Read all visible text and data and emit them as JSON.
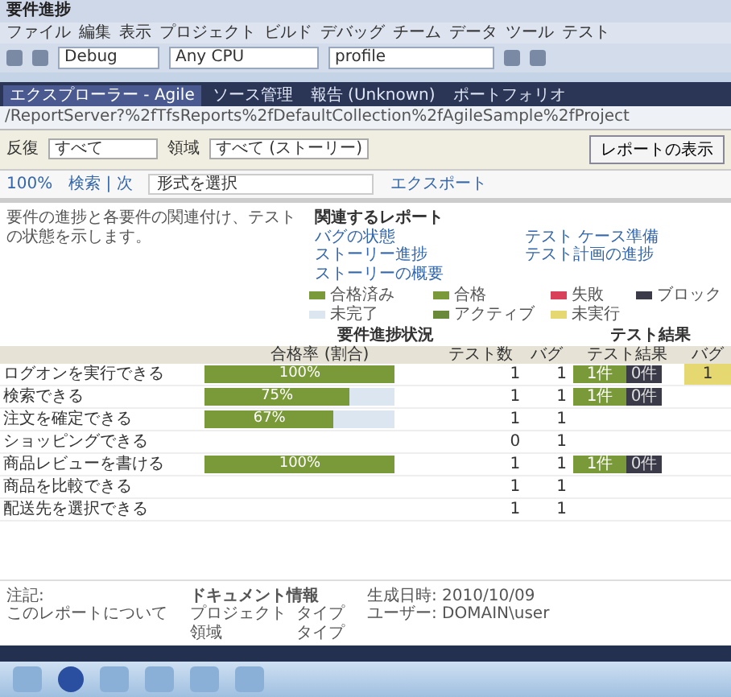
{
  "window": {
    "title": "要件進捗"
  },
  "menu": [
    "ファイル",
    "編集",
    "表示",
    "プロジェクト",
    "ビルド",
    "デバッグ",
    "チーム",
    "データ",
    "ツール",
    "テスト"
  ],
  "toolbar": {
    "configuration": "Debug",
    "platform": "Any CPU",
    "find": "profile"
  },
  "tabs": [
    {
      "label": "エクスプローラー - Agile",
      "selected": true
    },
    {
      "label": "ソース管理",
      "selected": false
    },
    {
      "label": "報告 (Unknown)",
      "selected": false
    },
    {
      "label": "ポートフォリオ",
      "selected": false
    }
  ],
  "address": "/ReportServer?%2fTfsReports%2fDefaultCollection%2fAgileSample%2fProject",
  "parameters": [
    {
      "label": "反復",
      "value": "すべて"
    },
    {
      "label": "領域",
      "value": "すべて (ストーリー)"
    }
  ],
  "view_report_button": "レポートの表示",
  "report_toolbar": {
    "zoom": "100%",
    "find_label": "検索 | 次",
    "export_placeholder": "形式を選択",
    "export_link": "エクスポート"
  },
  "description": "要件の進捗と各要件の関連付け、テストの状態を示します。",
  "related": {
    "title": "関連するレポート",
    "links": [
      "バグの状態",
      "テスト ケース準備",
      "ストーリー進捗",
      "テスト計画の進捗",
      "ストーリーの概要"
    ]
  },
  "legend_progress": [
    {
      "label": "合格済み",
      "color": "#7a9a3a"
    },
    {
      "label": "未完了",
      "color": "#dce6f0"
    }
  ],
  "legend_results": [
    {
      "label": "合格",
      "color": "#7a9a3a"
    },
    {
      "label": "失敗",
      "color": "#d9405a"
    },
    {
      "label": "ブロック",
      "color": "#3a3a48"
    },
    {
      "label": "アクティブ",
      "color": "#6a8a3a"
    },
    {
      "label": "未実行",
      "color": "#e6d870"
    }
  ],
  "table": {
    "group_headers": [
      "要件進捗状況",
      "テスト結果"
    ],
    "columns": [
      "合格率 (割合)",
      "テスト数",
      "バグ",
      "テスト結果",
      "バグ"
    ],
    "rows": [
      {
        "name": "ログオンを実行できる",
        "level": 1,
        "bar_label": "100%",
        "tests": "1",
        "bugs": "1",
        "pass": "1件",
        "fail": "0件",
        "active": "1"
      },
      {
        "name": "検索できる",
        "level": 0.76,
        "bar_label": "75%",
        "tests": "1",
        "bugs": "1",
        "pass": "1件",
        "fail": "0件"
      },
      {
        "name": "注文を確定できる",
        "level": 0.68,
        "bar_label": "67%",
        "tests": "1",
        "bugs": "1"
      },
      {
        "name": "ショッピングできる",
        "level": null,
        "tests": "0",
        "bugs": "1"
      },
      {
        "name": "商品レビューを書ける",
        "level": 1,
        "bar_label": "100%",
        "tests": "1",
        "bugs": "1",
        "pass": "1件",
        "fail": "0件"
      },
      {
        "name": "商品を比較できる",
        "level": null,
        "tests": "1",
        "bugs": "1"
      },
      {
        "name": "配送先を選択できる",
        "level": null,
        "tests": "1",
        "bugs": "1"
      }
    ]
  },
  "footer": {
    "notes": [
      "注記:",
      "このレポートについて"
    ],
    "info_title": "ドキュメント情報",
    "info": [
      {
        "label": "プロジェクト",
        "value": "タイプ"
      },
      {
        "label": "領域",
        "value": "タイプ"
      }
    ],
    "meta": [
      "生成日時: 2010/10/09",
      "ユーザー: DOMAIN\\user"
    ]
  }
}
